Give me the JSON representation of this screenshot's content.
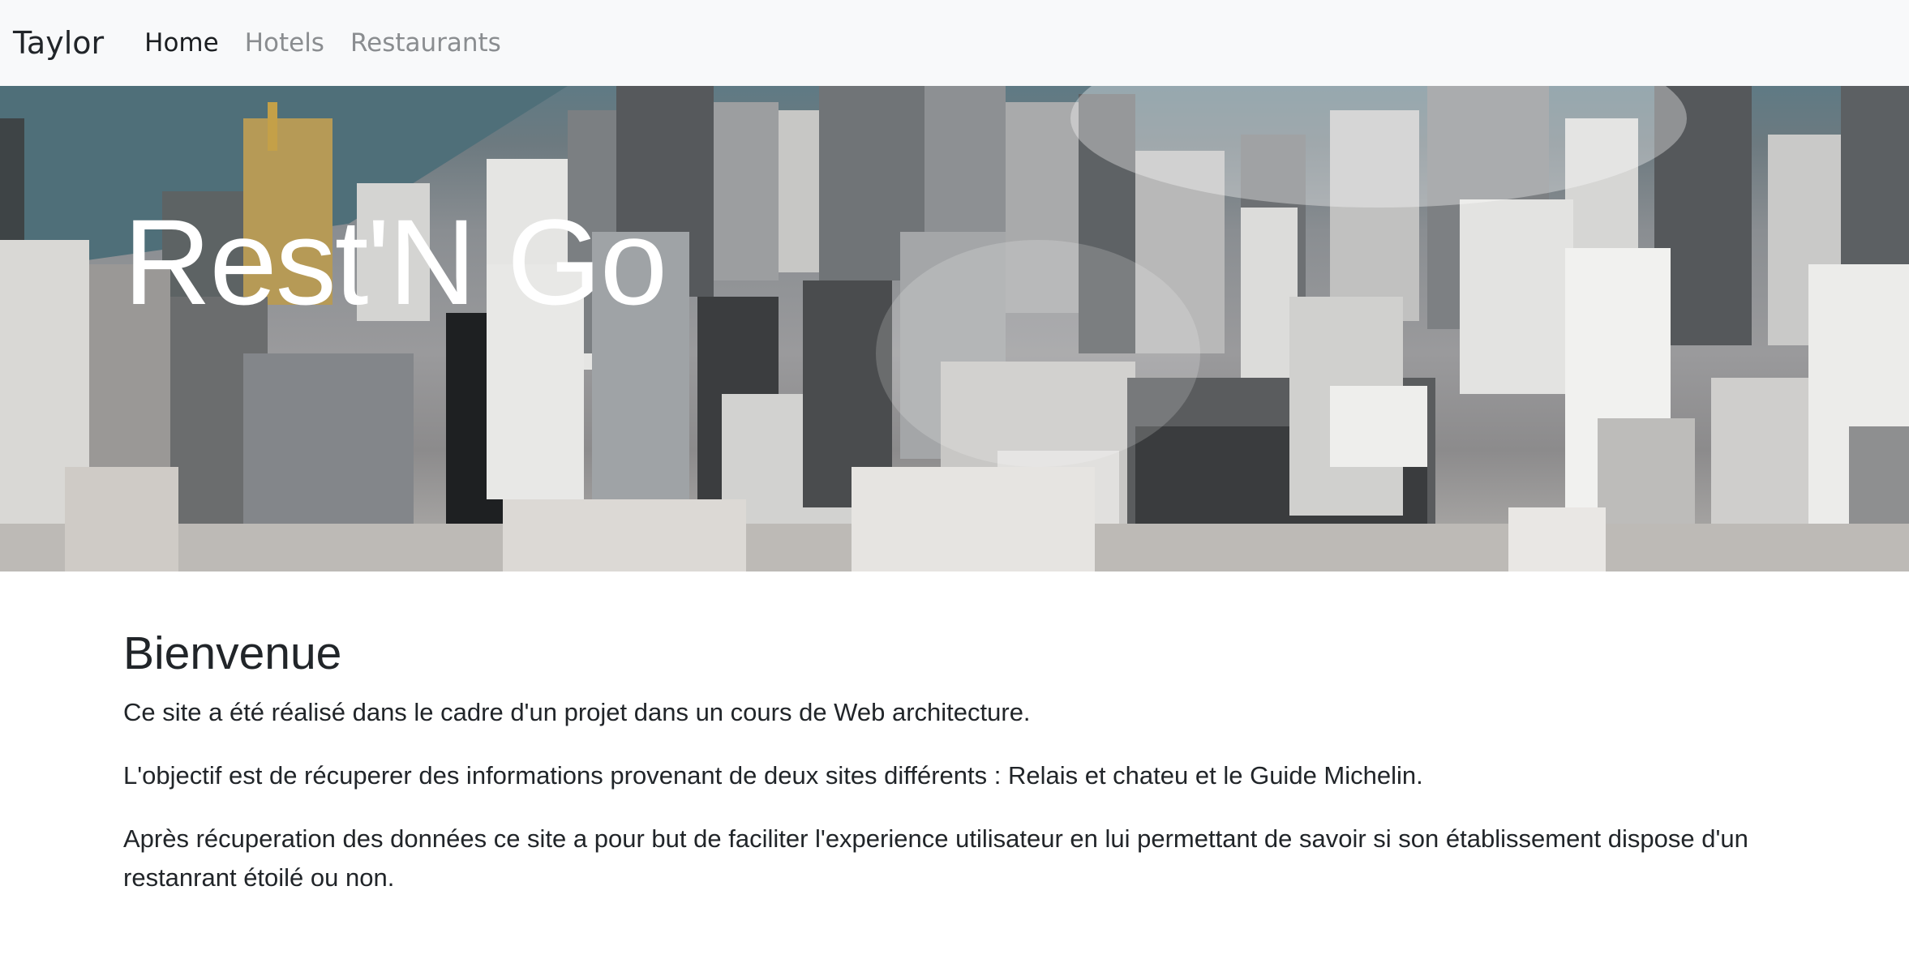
{
  "navbar": {
    "brand": "Taylor",
    "links": [
      {
        "label": "Home",
        "active": true
      },
      {
        "label": "Hotels",
        "active": false
      },
      {
        "label": "Restaurants",
        "active": false
      }
    ]
  },
  "hero": {
    "title": "Rest'N Go"
  },
  "main": {
    "heading": "Bienvenue",
    "paragraphs": [
      "Ce site a été réalisé dans le cadre d'un projet dans un cours de Web architecture.",
      "L'objectif est de récuperer des informations provenant de deux sites différents : Relais et chateu et le Guide Michelin.",
      "Après récuperation des données ce site a pour but de faciliter l'experience utilisateur en lui permettant de savoir si son établissement dispose d'un restanrant étoilé ou non."
    ]
  },
  "colors": {
    "navbar_bg": "#f8f9fa",
    "nav_active": "#1b1e21",
    "nav_inactive": "#8a8d90",
    "text": "#212529"
  }
}
